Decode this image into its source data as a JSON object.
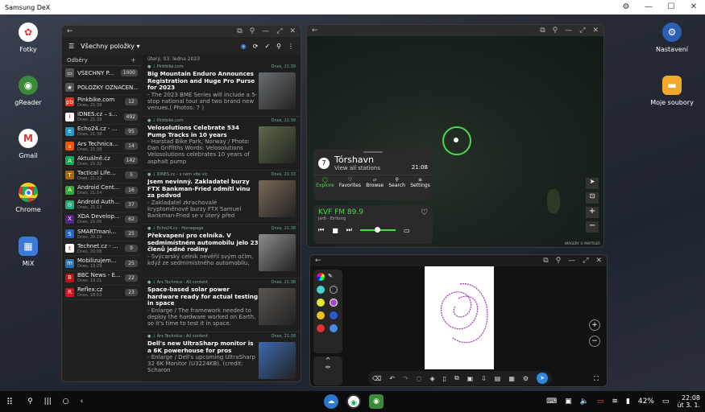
{
  "titlebar": {
    "title": "Samsung DeX"
  },
  "desktop": {
    "left_icons": [
      {
        "label": "Fotky",
        "icon": "pinwheel-icon"
      },
      {
        "label": "gReader",
        "icon": "rss-icon"
      },
      {
        "label": "Gmail",
        "icon": "gmail-icon"
      },
      {
        "label": "Chrome",
        "icon": "chrome-icon"
      },
      {
        "label": "MiX",
        "icon": "mix-icon"
      }
    ],
    "right_icons": [
      {
        "label": "Nastavení",
        "icon": "gear-icon"
      },
      {
        "label": "Moje soubory",
        "icon": "folder-icon"
      }
    ]
  },
  "reader": {
    "filter_label": "Všechny položky",
    "sidebar_header": "Odběry",
    "date_header": "úterý, 03. ledna 2023",
    "feeds": [
      {
        "name": "VŠECHNY P...",
        "sub": "",
        "count": "1000",
        "color": "#555",
        "glyph": "▭"
      },
      {
        "name": "POLOŽKY OZNAČEN...",
        "sub": "",
        "count": "",
        "color": "#555",
        "glyph": "★"
      },
      {
        "name": "Pinkbike.com",
        "sub": "Dnes, 21:39",
        "count": "12",
        "color": "#d32",
        "glyph": "pb"
      },
      {
        "name": "iDNES.cz – s...",
        "sub": "Dnes, 21:39",
        "count": "492",
        "color": "#fff",
        "glyph": "i"
      },
      {
        "name": "Echo24.cz - ...",
        "sub": "Dnes, 21:38",
        "count": "95",
        "color": "#29c",
        "glyph": "e"
      },
      {
        "name": "Ars Technica...",
        "sub": "Dnes, 21:38",
        "count": "14",
        "color": "#e50",
        "glyph": "a"
      },
      {
        "name": "Aktuálně.cz",
        "sub": "Dnes, 21:32",
        "count": "142",
        "color": "#1a5",
        "glyph": "A"
      },
      {
        "name": "Tactical Life...",
        "sub": "Dnes, 21:22",
        "count": "5",
        "color": "#a60",
        "glyph": "T"
      },
      {
        "name": "Android Cent...",
        "sub": "Dnes, 21:14",
        "count": "16",
        "color": "#3a3",
        "glyph": "A"
      },
      {
        "name": "Android Auth...",
        "sub": "Dnes, 21:13",
        "count": "37",
        "color": "#2a7",
        "glyph": "◎"
      },
      {
        "name": "XDA Develop...",
        "sub": "Dnes, 21:05",
        "count": "62",
        "color": "#528",
        "glyph": "X"
      },
      {
        "name": "SMARTmani...",
        "sub": "Dnes, 20:19",
        "count": "25",
        "color": "#26c",
        "glyph": "S"
      },
      {
        "name": "Technet.cz - ...",
        "sub": "Dnes, 20:08",
        "count": "9",
        "color": "#fff",
        "glyph": "t"
      },
      {
        "name": "Mobilizujem...",
        "sub": "Dnes, 19:29",
        "count": "25",
        "color": "#27b",
        "glyph": "m"
      },
      {
        "name": "BBC News - E...",
        "sub": "Dnes, 19:21",
        "count": "22",
        "color": "#b11",
        "glyph": "B"
      },
      {
        "name": "Reflex.cz",
        "sub": "Dnes, 18:53",
        "count": "23",
        "color": "#d12",
        "glyph": "R"
      }
    ],
    "articles": [
      {
        "source": "Pinkbike.com",
        "date": "Dnes, 21:39",
        "title": "Big Mountain Enduro Announces Registration and Huge Pro Purse for 2023",
        "excerpt": " - The 2023 BME Series will include a 5-stop national tour and two brand new venues.( Photos: 7 )",
        "thumb": "#6a6e72"
      },
      {
        "source": "Pinkbike.com",
        "date": "Dnes, 21:39",
        "title": "Velosolutions Celebrate 534 Pump Tracks in 10 years",
        "excerpt": " - Harstad Bike Park, Norway / Photo: Dan Griffiths Words: Velosolutions Velosolutions celebrates 10 years of asphalt pump",
        "thumb": "#5c6a4a"
      },
      {
        "source": "iDNES.cz – s ném vite vic",
        "date": "Dnes, 21:33",
        "title": "Jsem nevinný. Zakladatel burzy FTX Bankman-Fried odmítl vinu za podvod",
        "excerpt": " - Zakladatel zkrachovalé kryptoměnové burzy FTX Samuel Bankman-Fried se v úterý před",
        "thumb": "#7a6a58"
      },
      {
        "source": "Echo24.cz - Homepage",
        "date": "Dnes, 21:38",
        "title": "Překvapení pro celníka. V sedmimístném automobilu jelo 23 členů jedné rodiny",
        "excerpt": " - Švýcarský celník nevěřil svým očím, když ze sedmimístného automobilu,",
        "thumb": "#8a8c8e"
      },
      {
        "source": "Ars Technica - All content",
        "date": "Dnes, 21:38",
        "title": "Space-based solar power hardware ready for actual testing in space",
        "excerpt": " - Enlarge / The framework needed to deploy the hardware worked on Earth, so it's time to test it in space.",
        "thumb": "#5a5550"
      },
      {
        "source": "Ars Technica - All content",
        "date": "Dnes, 21:38",
        "title": "Dell's new UltraSharp monitor is a 6K powerhouse for pros",
        "excerpt": " - Enlarge / Dell's upcoming UltraSharp 32 6K Monitor (U3224KB). (credit: Scharon",
        "thumb": "#3a6ab0"
      }
    ]
  },
  "radio": {
    "station_number": "7",
    "city": "Tórshavn",
    "link": "View all stations",
    "time": "21:08",
    "tabs": [
      "Explore",
      "Favorites",
      "Browse",
      "Search",
      "Settings"
    ],
    "now_playing": "KVF FM 89.9",
    "now_sub": "Jarð - Eiriborg",
    "map_credit": "IMAGERY © MAPTILER"
  },
  "taskbar": {
    "battery": "42%",
    "time": "22:08",
    "date": "út 3. 1."
  }
}
